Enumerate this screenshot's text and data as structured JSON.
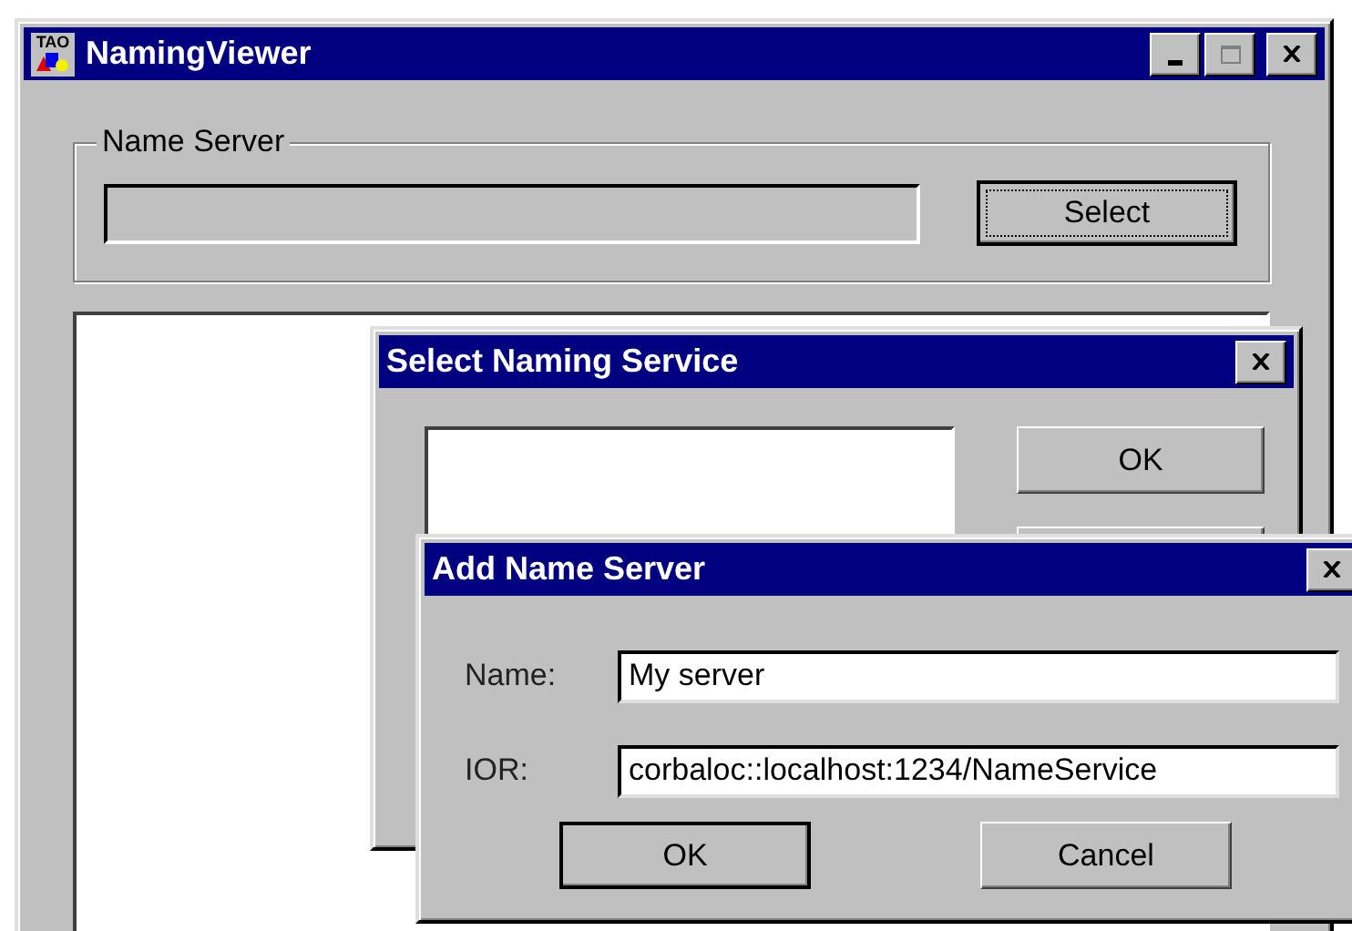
{
  "main_window": {
    "title": "NamingViewer",
    "icon_label": "TAO",
    "name_server_group": {
      "label": "Name Server",
      "select_button": {
        "label": "Select",
        "focused": true
      }
    }
  },
  "select_dialog": {
    "title": "Select Naming Service",
    "buttons": [
      {
        "label": "OK",
        "default": false
      }
    ]
  },
  "add_dialog": {
    "title": "Add Name Server",
    "fields": [
      {
        "label": "Name:",
        "value": "My server"
      },
      {
        "label": "IOR:",
        "value": "corbaloc::localhost:1234/NameService"
      }
    ],
    "buttons": [
      {
        "label": "OK",
        "default": true
      },
      {
        "label": "Cancel",
        "default": false
      }
    ]
  }
}
